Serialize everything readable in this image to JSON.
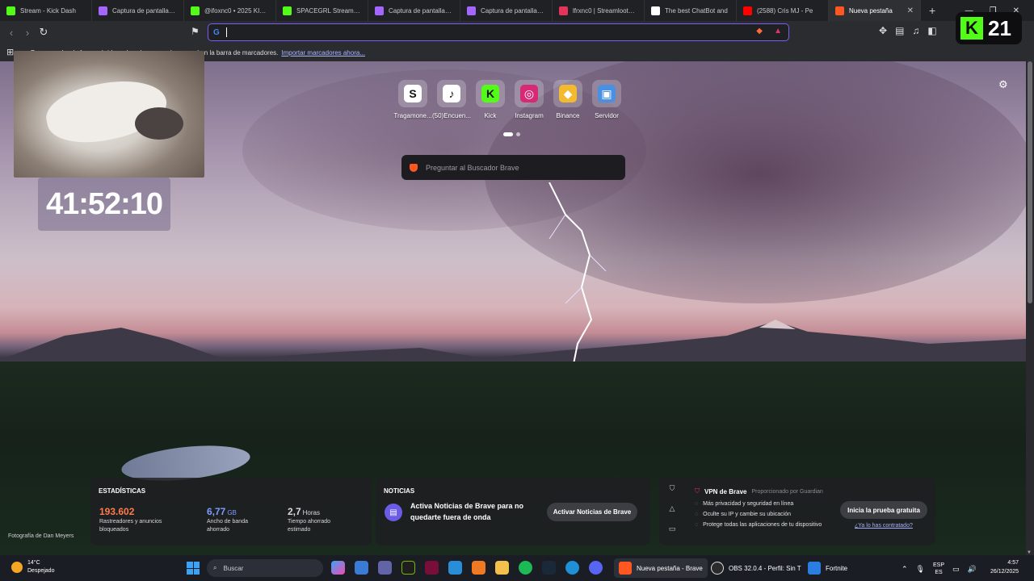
{
  "browser": {
    "tabs": [
      {
        "label": "Stream - Kick Dash",
        "icon_color": "#53fc18",
        "icon": "kick-icon"
      },
      {
        "label": "Captura de pantalla pa",
        "icon_color": "#a566ff",
        "icon": "feather-icon"
      },
      {
        "label": "@ifoxnc0 • 2025 KICK V",
        "icon_color": "#53fc18",
        "icon": "kick-icon"
      },
      {
        "label": "SPACEGRL Stream - Vi",
        "icon_color": "#53fc18",
        "icon": "kick-icon"
      },
      {
        "label": "Captura de pantalla pa",
        "icon_color": "#a566ff",
        "icon": "feather-icon"
      },
      {
        "label": "Captura de pantalla pa",
        "icon_color": "#a566ff",
        "icon": "feather-icon"
      },
      {
        "label": "lfrxnc0 | Streamloots | U",
        "icon_color": "#e6335a",
        "icon": "streamloots-icon"
      },
      {
        "label": "The best ChatBot and",
        "icon_color": "#ffffff",
        "icon": "chatbot-icon"
      },
      {
        "label": "(2588) Cris MJ - Pe",
        "icon_color": "#ff0000",
        "icon": "youtube-icon"
      },
      {
        "label": "Nueva pestaña",
        "icon_color": "#ff5722",
        "icon": "brave-icon",
        "active": true
      }
    ],
    "omnibox_value": "",
    "bookmarks_bar": {
      "text": "Para acceder de forma rápida, coloca los marcadores aquí en la barra de marcadores.",
      "link": "Importar marcadores ahora..."
    }
  },
  "overlay": {
    "timer": "41:52:10",
    "kick_count": "21"
  },
  "newtab": {
    "shortcuts": [
      {
        "label": "Tragamone...",
        "glyph": "S",
        "bg": "#ffffff",
        "fg": "#111111",
        "icon": "substack-icon"
      },
      {
        "label": "(50)Encuen...",
        "glyph": "♪",
        "bg": "#ffffff",
        "fg": "#111111",
        "icon": "tiktok-icon"
      },
      {
        "label": "Kick",
        "glyph": "K",
        "bg": "#53fc18",
        "fg": "#0e0e10",
        "icon": "kick-icon"
      },
      {
        "label": "Instagram",
        "glyph": "◎",
        "bg": "#d62976",
        "fg": "#ffffff",
        "icon": "instagram-icon"
      },
      {
        "label": "Binance",
        "glyph": "◆",
        "bg": "#f3ba2f",
        "fg": "#ffffff",
        "icon": "binance-icon"
      },
      {
        "label": "Servidor",
        "glyph": "▣",
        "bg": "#4a90e2",
        "fg": "#ffffff",
        "icon": "server-icon"
      }
    ],
    "search_placeholder": "Preguntar al Buscador Brave",
    "photo_credit": "Fotografía de Dan Meyers"
  },
  "stats": {
    "title": "ESTADÍSTICAS",
    "trackers": {
      "value": "193.602",
      "label1": "Rastreadores y anuncios",
      "label2": "bloqueados",
      "color": "#ff7a4d"
    },
    "bandwidth": {
      "value": "6,77",
      "unit": "GB",
      "label1": "Ancho de banda",
      "label2": "ahorrado",
      "color": "#7e9cff"
    },
    "time": {
      "value": "2,7",
      "unit": "Horas",
      "label1": "Tiempo ahorrado",
      "label2": "estimado",
      "color": "#ffffff"
    }
  },
  "news": {
    "title": "NOTICIAS",
    "text": "Activa Noticias de Brave para no quedarte fuera de onda",
    "button": "Activar Noticias de Brave"
  },
  "vpn": {
    "title": "VPN de Brave",
    "provider": "Proporcionado por Guardian",
    "features": [
      "Más privacidad y seguridad en línea",
      "Oculte su IP y cambie su ubicación",
      "Protege todas las aplicaciones de tu dispositivo"
    ],
    "button": "Inicia la prueba gratuita",
    "link": "¿Ya lo has contratado?"
  },
  "taskbar": {
    "weather_temp": "14°C",
    "weather_desc": "Despejado",
    "search_label": "Buscar",
    "brave_window": "Nueva pestaña - Brave",
    "obs_window": "OBS 32.0.4 - Perfil: Sin T",
    "fortnite_window": "Fortnite",
    "lang_top": "ESP",
    "lang_bottom": "ES",
    "time": "4:57",
    "date": "26/12/2025"
  }
}
